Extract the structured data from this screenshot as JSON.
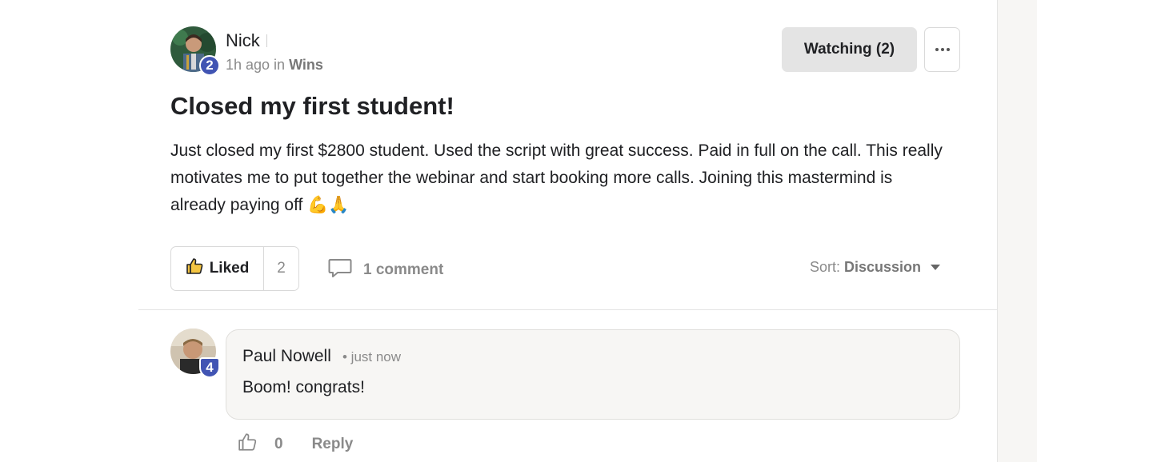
{
  "post": {
    "author": {
      "name": "Nick",
      "level": "2"
    },
    "meta": {
      "time": "1h ago in",
      "category": "Wins"
    },
    "watch_label": "Watching (2)",
    "title": "Closed my first student!",
    "body": "Just closed my first $2800 student. Used the script with great success. Paid in full on the call. This really motivates me to put together the webinar and start booking more calls. Joining this mastermind is already paying off 💪🙏",
    "like_label": "Liked",
    "like_count": "2",
    "comment_count_label": "1 comment",
    "sort": {
      "label": "Sort:",
      "value": "Discussion"
    }
  },
  "comment": {
    "author": "Paul Nowell",
    "level": "4",
    "time": "• just now",
    "text": "Boom! congrats!",
    "like_count": "0",
    "reply_label": "Reply"
  },
  "colors": {
    "level_badge": "#4154b3",
    "watch_bg": "#e4e4e4",
    "comment_bg": "#f7f6f4"
  }
}
